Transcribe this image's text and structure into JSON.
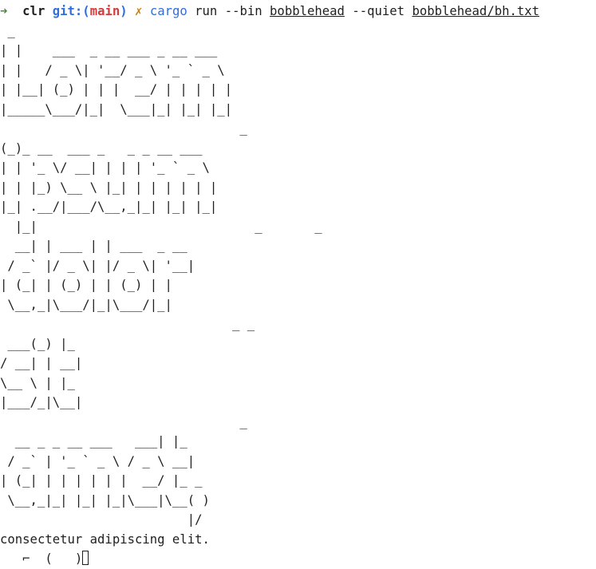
{
  "prompt": {
    "arrow": "➜",
    "dir": "clr",
    "git_label": "git:",
    "paren_open": "(",
    "branch": "main",
    "paren_close": ")",
    "dirty_mark": "✗"
  },
  "command": {
    "program": "cargo",
    "args_1": "run --bin",
    "bin_name": "bobblehead",
    "args_2": "--quiet",
    "file_path": "bobblehead/bh.txt"
  },
  "ascii_art": " _\n| |    ___  _ __ ___ _ __ ___\n| |   / _ \\| '__/ _ \\ '_ ` _ \\\n| |__| (_) | | |  __/ | | | | |\n|_____\\___/|_|  \\___|_| |_| |_|\n                                _\n(_)_ __  ___ _   _ _ __ ___\n| | '_ \\/ __| | | | '_ ` _ \\\n| | |_) \\__ \\ |_| | | | | | |\n|_| .__/|___/\\__,_|_| |_| |_|\n  |_|                             _       _\n  __| | ___ | | ___  _ __\n / _` |/ _ \\| |/ _ \\| '__|\n| (_| | (_) | | (_) | |\n \\__,_|\\___/|_|\\___/|_|\n                               _ _\n ___(_) |_\n/ __| | __|\n\\__ \\ | |_\n|___/_|\\__|\n                                _\n  __ _ _ __ ___   ___| |_\n / _` | '_ ` _ \\ / _ \\ __|\n| (_| | | | | | |  __/ |_ _\n \\__,_|_| |_| |_|\\___|\\__( )\n                         |/",
  "output_text": "consectetur adipiscing elit.",
  "next_prompt_fragment": "   ⌐  (   )"
}
